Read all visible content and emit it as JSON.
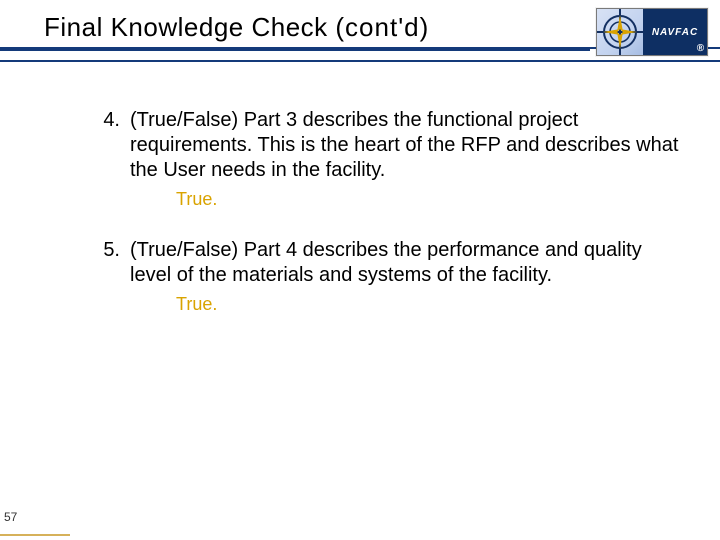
{
  "title": {
    "part1": "Final Knowledge Check ",
    "part2": "(cont'd)"
  },
  "logo": {
    "brand": "NAVFAC",
    "registered": "®"
  },
  "questions": [
    {
      "num": "4.",
      "text": "(True/False) Part 3 describes the functional project requirements.  This is the heart of the RFP and describes what the User needs in the facility.",
      "answer": "True."
    },
    {
      "num": "5.",
      "text": "(True/False) Part 4 describes the performance and quality level of the materials and systems of the facility.",
      "answer": "True."
    }
  ],
  "page_number": "57"
}
